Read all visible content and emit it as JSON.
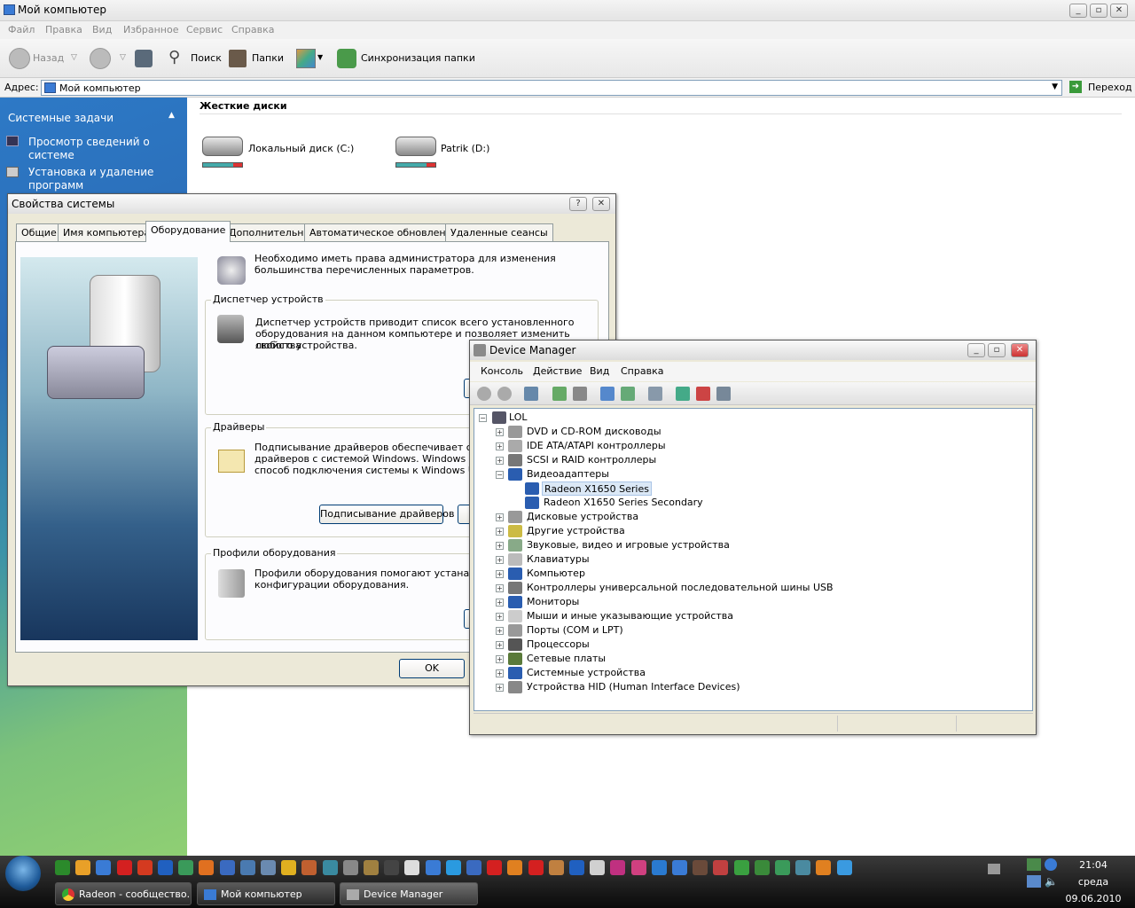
{
  "explorer": {
    "title": "Мой компьютер",
    "menu": [
      "Файл",
      "Правка",
      "Вид",
      "Избранное",
      "Сервис",
      "Справка"
    ],
    "toolbar": {
      "back": "Назад",
      "search": "Поиск",
      "folders": "Папки",
      "sync": "Синхронизация папки"
    },
    "address_label": "Адрес:",
    "address_value": "Мой компьютер",
    "go_label": "Переход",
    "tasks_header": "Системные задачи",
    "tasks": [
      "Просмотр сведений о системе",
      "Установка и удаление программ"
    ],
    "section_hard_disks": "Жесткие диски",
    "drives": [
      "Локальный диск (C:)",
      "Patrik (D:)"
    ],
    "drive_usage": [
      0.75,
      0.75
    ]
  },
  "sysprops": {
    "title": "Свойства системы",
    "tabs": [
      "Общие",
      "Имя компьютера",
      "Оборудование",
      "Дополнительно",
      "Автоматическое обновление",
      "Удаленные сеансы"
    ],
    "active_tab": "Оборудование",
    "admin_note_l1": "Необходимо иметь права администратора для изменения",
    "admin_note_l2": "большинства перечисленных параметров.",
    "devmgr_group": "Диспетчер устройств",
    "devmgr_l1": "Диспетчер устройств приводит список всего установленного",
    "devmgr_l2": "оборудования на данном компьютере и позволяет изменить свойства",
    "devmgr_l3": "любого устройства.",
    "drivers_group": "Драйверы",
    "drivers_l1": "Подписывание драйверов обеспечивает совме",
    "drivers_l2": "драйверов с системой Windows.  Windows Upda",
    "drivers_l3": "способ подключения системы к Windows Updat",
    "driver_signing_button": "Подписывание драйверов",
    "profiles_group": "Профили оборудования",
    "profiles_l1": "Профили оборудования помогают устанавливать",
    "profiles_l2": "конфигурации оборудования.",
    "ok_button": "OK"
  },
  "devmgr": {
    "title": "Device Manager",
    "menu": [
      "Консоль",
      "Действие",
      "Вид",
      "Справка"
    ],
    "root": "LOL",
    "nodes": [
      "DVD и CD-ROM дисководы",
      "IDE ATA/ATAPI контроллеры",
      "SCSI и RAID контроллеры",
      "Видеоадаптеры",
      "Дисковые устройства",
      "Другие устройства",
      "Звуковые, видео и игровые устройства",
      "Клавиатуры",
      "Компьютер",
      "Контроллеры универсальной последовательной шины USB",
      "Мониторы",
      "Мыши и иные указывающие устройства",
      "Порты (COM и LPT)",
      "Процессоры",
      "Сетевые платы",
      "Системные устройства",
      "Устройства HID (Human Interface Devices)"
    ],
    "video_children": [
      "Radeon X1650 Series",
      "Radeon X1650 Series Secondary"
    ]
  },
  "taskbar": {
    "tasks": [
      "Radeon - сообщество...",
      "Мой компьютер",
      "Device Manager"
    ],
    "time": "21:04",
    "day": "среда",
    "date": "09.06.2010"
  }
}
